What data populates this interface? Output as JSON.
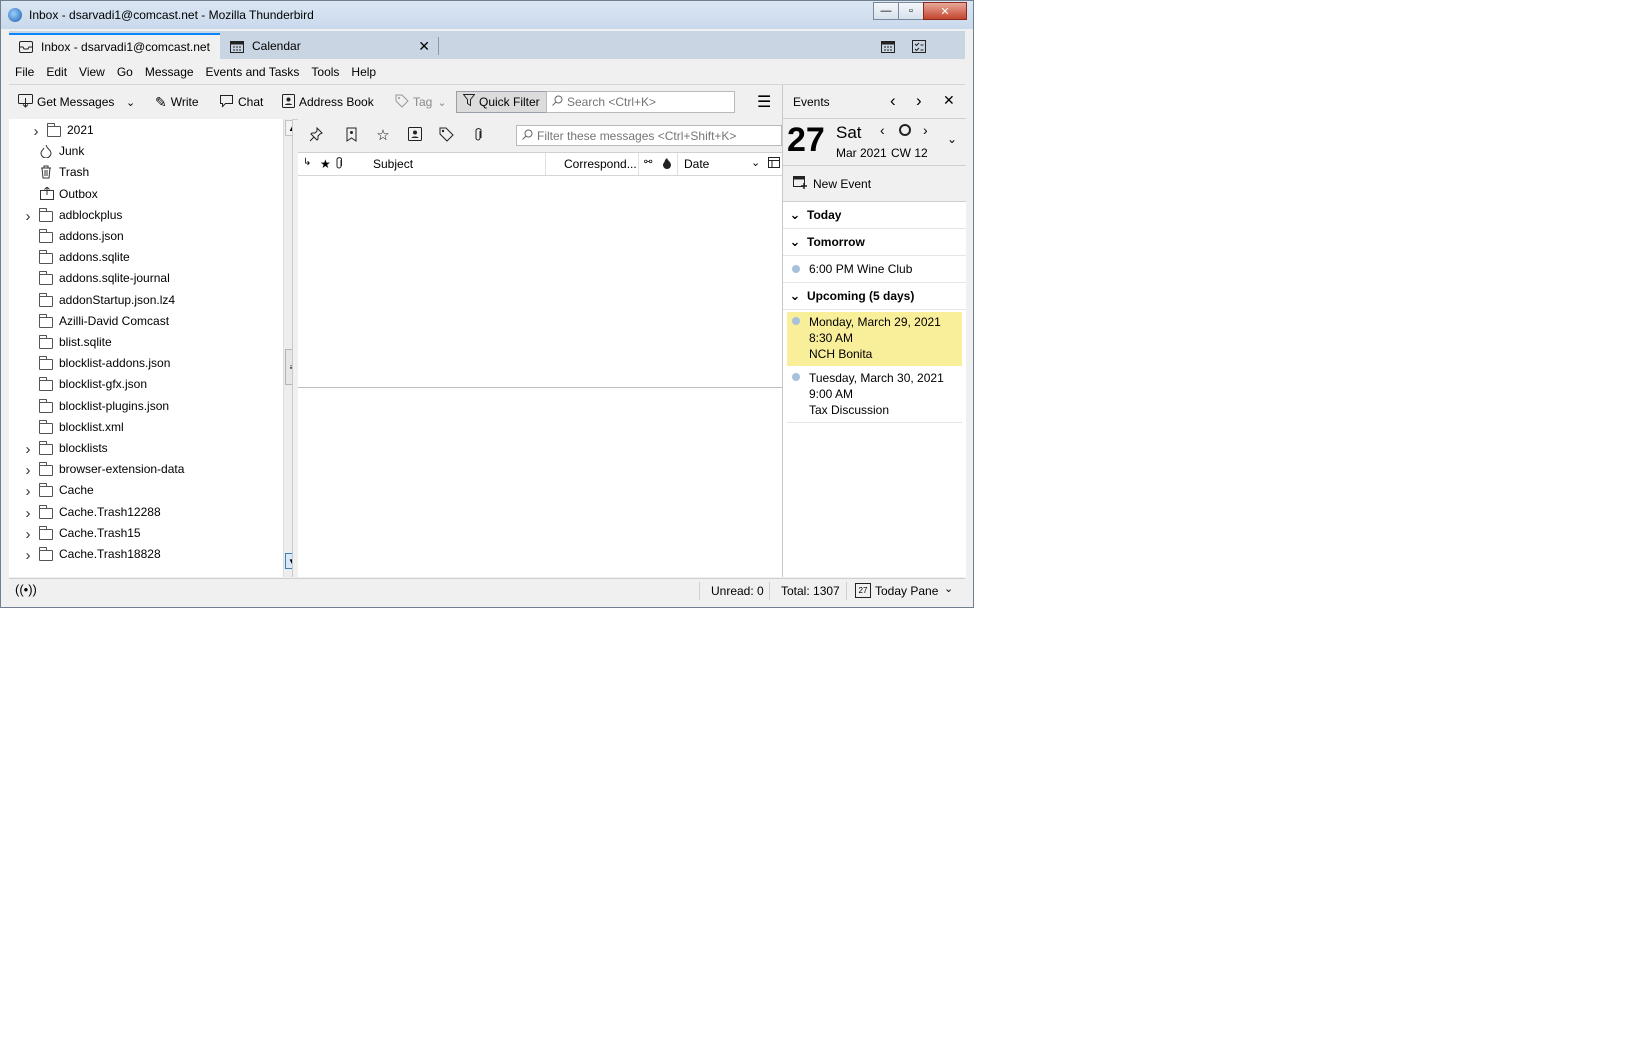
{
  "window": {
    "title": "Inbox - dsarvadi1@comcast.net - Mozilla Thunderbird",
    "caption": {
      "minimize": "—",
      "maximize": "▫",
      "close": "✕"
    }
  },
  "tabs": [
    {
      "label": "Inbox - dsarvadi1@comcast.net",
      "icon": "inbox-icon",
      "active": true
    },
    {
      "label": "Calendar",
      "icon": "calendar-icon",
      "active": false,
      "close": "✕"
    }
  ],
  "menu": [
    "File",
    "Edit",
    "View",
    "Go",
    "Message",
    "Events and Tasks",
    "Tools",
    "Help"
  ],
  "toolbar": {
    "get_messages": "Get Messages",
    "write": "Write",
    "chat": "Chat",
    "address_book": "Address Book",
    "tag": "Tag",
    "quick_filter": "Quick Filter",
    "search_placeholder": "Search <Ctrl+K>",
    "menu_glyph": "☰"
  },
  "folders": [
    {
      "label": "2021",
      "expandable": true,
      "indent": 1,
      "icon": "folder-icon"
    },
    {
      "label": "Junk",
      "expandable": false,
      "indent": 0,
      "icon": "junk-icon"
    },
    {
      "label": "Trash",
      "expandable": false,
      "indent": 0,
      "icon": "trash-icon"
    },
    {
      "label": "Outbox",
      "expandable": false,
      "indent": 0,
      "icon": "outbox-icon"
    },
    {
      "label": "adblockplus",
      "expandable": true,
      "indent": 0,
      "icon": "folder-icon"
    },
    {
      "label": "addons.json",
      "expandable": false,
      "indent": 0,
      "icon": "folder-icon"
    },
    {
      "label": "addons.sqlite",
      "expandable": false,
      "indent": 0,
      "icon": "folder-icon"
    },
    {
      "label": "addons.sqlite-journal",
      "expandable": false,
      "indent": 0,
      "icon": "folder-icon"
    },
    {
      "label": "addonStartup.json.lz4",
      "expandable": false,
      "indent": 0,
      "icon": "folder-icon"
    },
    {
      "label": "Azilli-David Comcast",
      "expandable": false,
      "indent": 0,
      "icon": "folder-icon"
    },
    {
      "label": "blist.sqlite",
      "expandable": false,
      "indent": 0,
      "icon": "folder-icon"
    },
    {
      "label": "blocklist-addons.json",
      "expandable": false,
      "indent": 0,
      "icon": "folder-icon"
    },
    {
      "label": "blocklist-gfx.json",
      "expandable": false,
      "indent": 0,
      "icon": "folder-icon"
    },
    {
      "label": "blocklist-plugins.json",
      "expandable": false,
      "indent": 0,
      "icon": "folder-icon"
    },
    {
      "label": "blocklist.xml",
      "expandable": false,
      "indent": 0,
      "icon": "folder-icon"
    },
    {
      "label": "blocklists",
      "expandable": true,
      "indent": 0,
      "icon": "folder-icon"
    },
    {
      "label": "browser-extension-data",
      "expandable": true,
      "indent": 0,
      "icon": "folder-icon"
    },
    {
      "label": "Cache",
      "expandable": true,
      "indent": 0,
      "icon": "folder-icon"
    },
    {
      "label": "Cache.Trash12288",
      "expandable": true,
      "indent": 0,
      "icon": "folder-icon"
    },
    {
      "label": "Cache.Trash15",
      "expandable": true,
      "indent": 0,
      "icon": "folder-icon"
    },
    {
      "label": "Cache.Trash18828",
      "expandable": true,
      "indent": 0,
      "icon": "folder-icon"
    }
  ],
  "message_list": {
    "filter_placeholder": "Filter these messages <Ctrl+Shift+K>",
    "columns": {
      "subject": "Subject",
      "correspondents": "Correspond...",
      "date": "Date"
    }
  },
  "today_pane": {
    "header": "Events",
    "day_number": "27",
    "weekday": "Sat",
    "month_year": "Mar 2021",
    "week": "CW 12",
    "new_event": "New Event",
    "sections": {
      "today": "Today",
      "tomorrow": "Tomorrow",
      "upcoming": "Upcoming (5 days)"
    },
    "tomorrow_event": "6:00 PM Wine Club",
    "upcoming_events": [
      {
        "date": "Monday, March 29, 2021",
        "time": "8:30 AM",
        "title": "NCH Bonita",
        "highlight": "#f9ef9a"
      },
      {
        "date": "Tuesday, March 30, 2021",
        "time": "9:00 AM",
        "title": "Tax Discussion"
      }
    ]
  },
  "status": {
    "unread": "Unread: 0",
    "total": "Total: 1307",
    "today_pane": "Today Pane",
    "today_pane_day": "27"
  },
  "colors": {
    "accent": "#0a84ff",
    "event_dot": "#a7c0dc",
    "highlight": "#f9ef9a"
  }
}
